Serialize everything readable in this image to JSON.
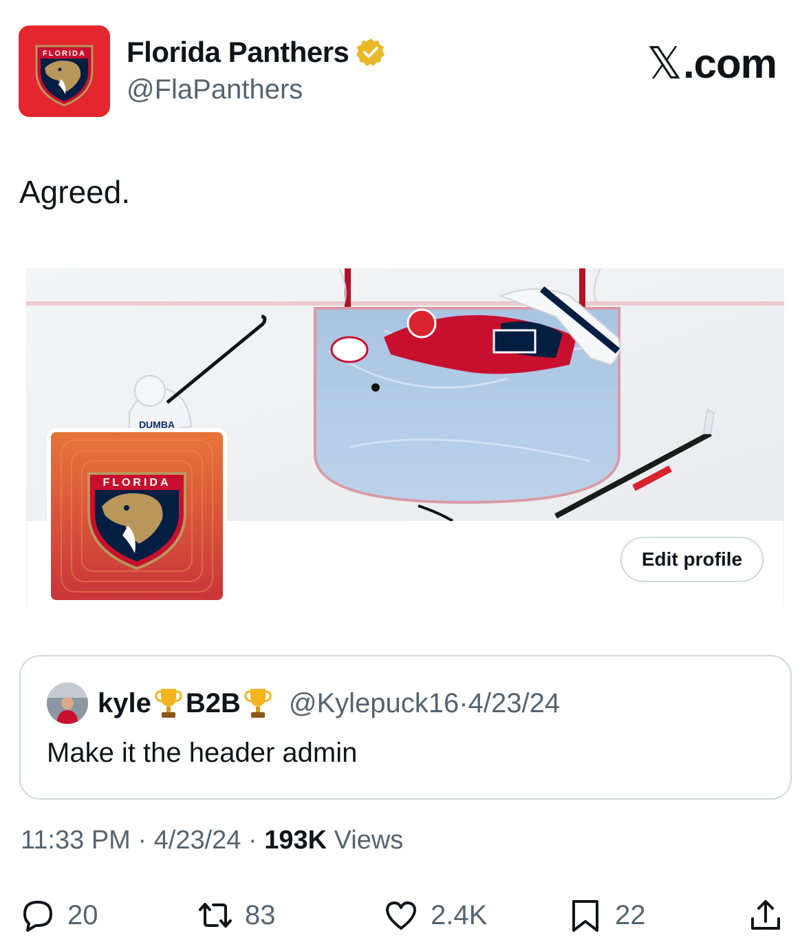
{
  "author": {
    "display_name": "Florida Panthers",
    "handle": "@FlaPanthers",
    "avatar_icon": "florida-panthers-logo",
    "verified_color": "#e8b829"
  },
  "site_label": {
    "x": "𝕏",
    "domain": ".com"
  },
  "tweet": {
    "text": "Agreed."
  },
  "media": {
    "edit_profile_label": "Edit profile",
    "jersey_text": "DUMBA"
  },
  "quoted": {
    "name_part1": "kyle",
    "name_part2": "B2B",
    "handle": "@Kylepuck16",
    "separator": "·",
    "date": "4/23/24",
    "text": "Make it the header admin",
    "trophy_icon": "trophy-icon"
  },
  "meta": {
    "time": "11:33 PM",
    "sep1": " · ",
    "date": "4/23/24",
    "sep2": " · ",
    "views_count": "193K",
    "views_label": " Views"
  },
  "actions": {
    "replies": "20",
    "reposts": "83",
    "likes": "2.4K",
    "bookmarks": "22"
  },
  "colors": {
    "text_primary": "#0f1419",
    "text_secondary": "#536471",
    "border": "#cfd9de",
    "panthers_red": "#e4262f"
  }
}
